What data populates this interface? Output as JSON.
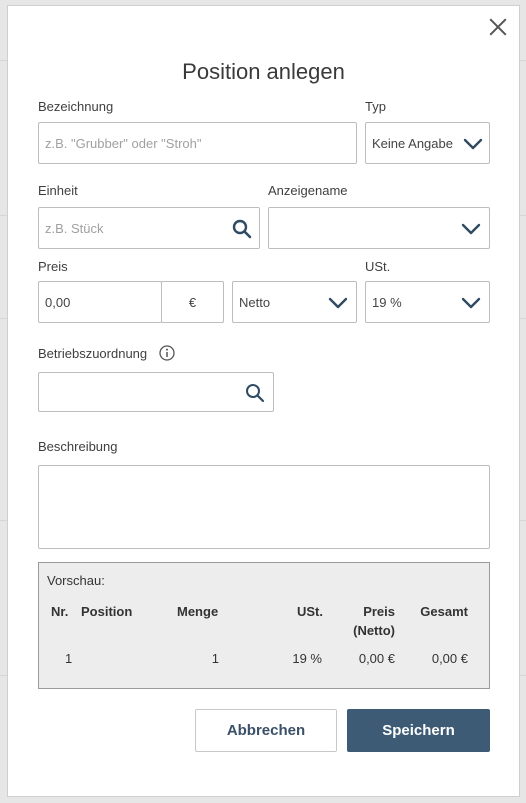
{
  "dialog": {
    "title": "Position anlegen",
    "close_icon": "close-icon"
  },
  "form": {
    "bezeichnung": {
      "label": "Bezeichnung",
      "placeholder": "z.B. \"Grubber\" oder \"Stroh\""
    },
    "typ": {
      "label": "Typ",
      "value": "Keine Angabe"
    },
    "einheit": {
      "label": "Einheit",
      "placeholder": "z.B. Stück"
    },
    "anzeigename": {
      "label": "Anzeigename",
      "value": ""
    },
    "preis": {
      "label": "Preis",
      "value": "0,00",
      "currency": "€",
      "mode": "Netto"
    },
    "ust": {
      "label": "USt.",
      "value": "19 %"
    },
    "betriebszuordnung": {
      "label": "Betriebszuordnung",
      "value": ""
    },
    "beschreibung": {
      "label": "Beschreibung",
      "value": ""
    }
  },
  "preview": {
    "title": "Vorschau:",
    "headers": {
      "nr": "Nr.",
      "position": "Position",
      "menge": "Menge",
      "ust": "USt.",
      "preis_1": "Preis",
      "preis_2": "(Netto)",
      "gesamt": "Gesamt"
    },
    "row": {
      "nr": "1",
      "position": "",
      "menge": "1",
      "ust": "19 %",
      "preis": "0,00 €",
      "gesamt": "0,00 €"
    }
  },
  "buttons": {
    "cancel": "Abbrechen",
    "save": "Speichern"
  },
  "colors": {
    "primary": "#3d5b75",
    "chevron": "#2f4a63",
    "border": "#bdbdbd",
    "preview_bg": "#ededed"
  }
}
